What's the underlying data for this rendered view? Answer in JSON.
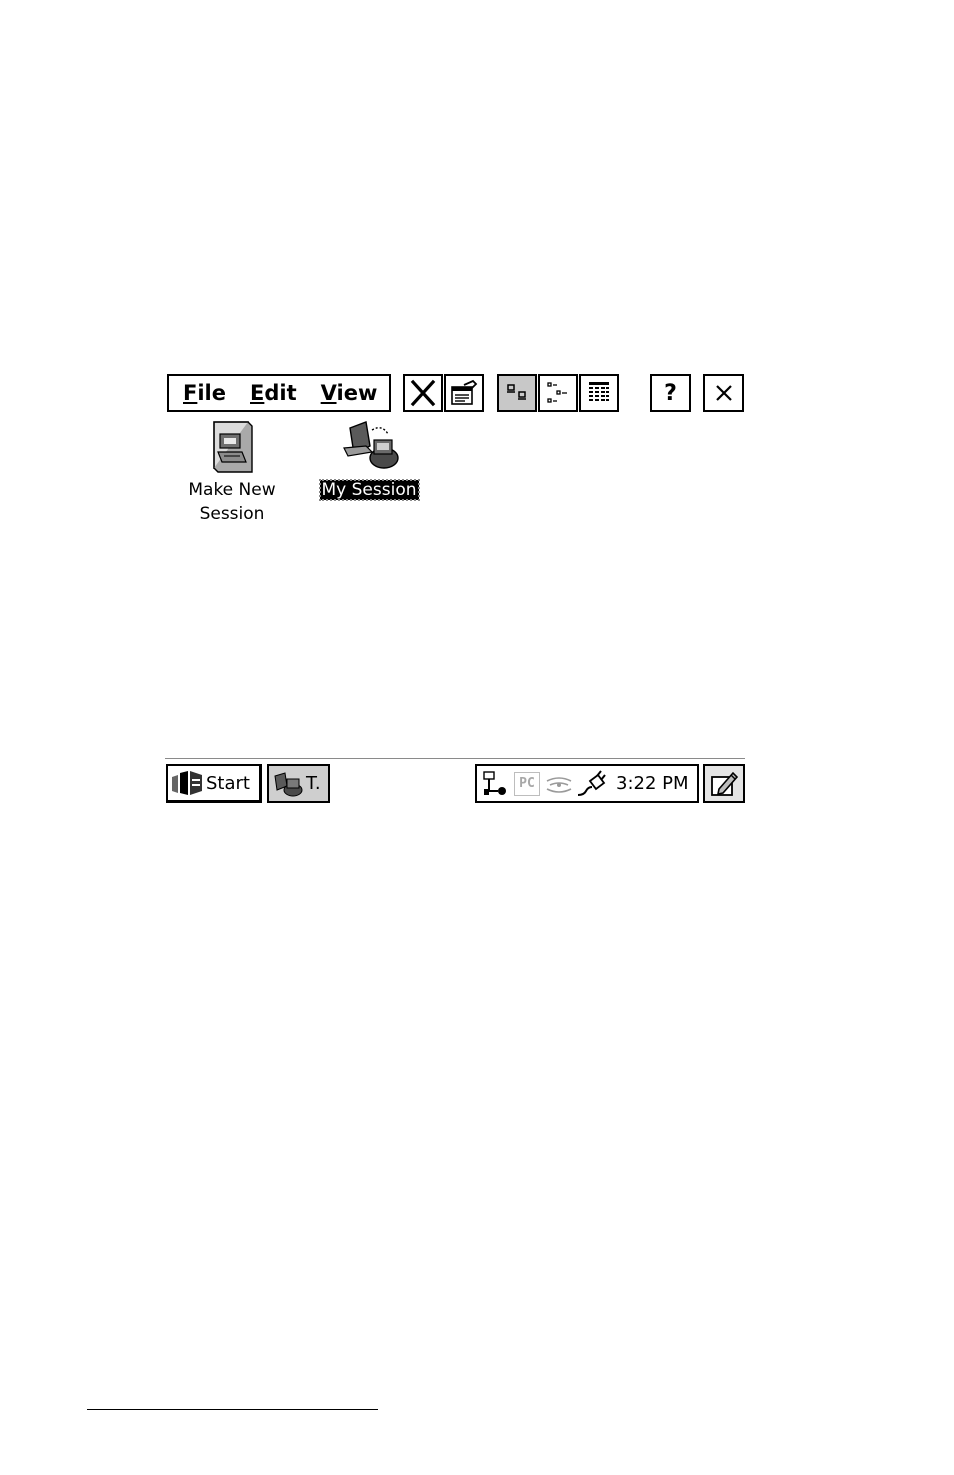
{
  "menubar": {
    "items": [
      {
        "accel": "F",
        "rest": "ile"
      },
      {
        "accel": "E",
        "rest": "dit"
      },
      {
        "accel": "V",
        "rest": "iew"
      }
    ]
  },
  "toolbar": {
    "buttons": [
      {
        "icon": "delete-x-icon"
      },
      {
        "icon": "properties-icon"
      },
      {
        "icon": "large-icons-view-icon",
        "pressed": true
      },
      {
        "icon": "small-icons-view-icon"
      },
      {
        "icon": "details-view-icon"
      },
      {
        "icon": "help-icon",
        "glyph": "?"
      },
      {
        "icon": "close-icon"
      }
    ]
  },
  "desktop": {
    "items": [
      {
        "label_line1": "Make New",
        "label_line2": "Session",
        "icon": "make-new-session-icon",
        "selected": false
      },
      {
        "label_line1": "My Session",
        "icon": "session-icon",
        "selected": true
      }
    ]
  },
  "taskbar": {
    "start_label": "Start",
    "task_label": "T.",
    "tray": {
      "pc_label": "PC",
      "clock": "3:22 PM",
      "icons": [
        "network-icon",
        "pc-card-icon",
        "infrared-icon",
        "power-plug-icon"
      ]
    },
    "pen_icon": "input-panel-icon"
  }
}
